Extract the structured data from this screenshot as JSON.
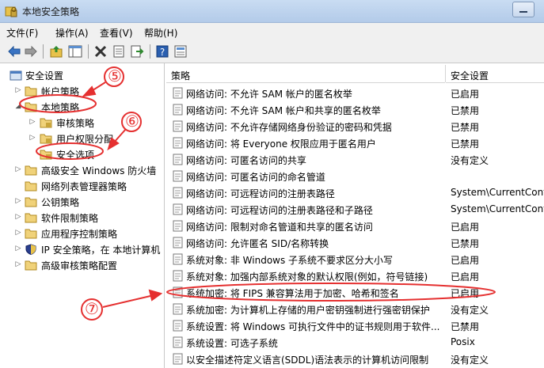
{
  "window": {
    "title": "本地安全策略"
  },
  "menu": [
    "文件(F)",
    "操作(A)",
    "查看(V)",
    "帮助(H)"
  ],
  "toolbar": [
    "back-icon",
    "forward-icon",
    "up-folder-icon",
    "show-tree-icon",
    "delete-icon",
    "properties-icon",
    "export-icon",
    "help-icon",
    "details-icon"
  ],
  "tree": {
    "root": "安全设置",
    "items": [
      "帐户策略",
      "本地策略",
      "审核策略",
      "用户权限分配",
      "安全选项",
      "高级安全 Windows 防火墙",
      "网络列表管理器策略",
      "公钥策略",
      "软件限制策略",
      "应用程序控制策略",
      "IP 安全策略，在 本地计算机",
      "高级审核策略配置"
    ]
  },
  "list": {
    "headers": [
      "策略",
      "安全设置"
    ],
    "rows": [
      {
        "name": "网络访问: 不允许 SAM 帐户的匿名枚举",
        "value": "已启用"
      },
      {
        "name": "网络访问: 不允许 SAM 帐户和共享的匿名枚举",
        "value": "已禁用"
      },
      {
        "name": "网络访问: 不允许存储网络身份验证的密码和凭据",
        "value": "已禁用"
      },
      {
        "name": "网络访问: 将 Everyone 权限应用于匿名用户",
        "value": "已禁用"
      },
      {
        "name": "网络访问: 可匿名访问的共享",
        "value": "没有定义"
      },
      {
        "name": "网络访问: 可匿名访问的命名管道",
        "value": ""
      },
      {
        "name": "网络访问: 可远程访问的注册表路径",
        "value": "System\\CurrentCont"
      },
      {
        "name": "网络访问: 可远程访问的注册表路径和子路径",
        "value": "System\\CurrentCont"
      },
      {
        "name": "网络访问: 限制对命名管道和共享的匿名访问",
        "value": "已启用"
      },
      {
        "name": "网络访问: 允许匿名 SID/名称转换",
        "value": "已禁用"
      },
      {
        "name": "系统对象: 非 Windows 子系统不要求区分大小写",
        "value": "已启用"
      },
      {
        "name": "系统对象: 加强内部系统对象的默认权限(例如，符号链接)",
        "value": "已启用"
      },
      {
        "name": "系统加密: 将 FIPS 兼容算法用于加密、哈希和签名",
        "value": "已启用"
      },
      {
        "name": "系统加密: 为计算机上存储的用户密钥强制进行强密钥保护",
        "value": "没有定义"
      },
      {
        "name": "系统设置: 将 Windows 可执行文件中的证书规则用于软件...",
        "value": "已禁用"
      },
      {
        "name": "系统设置: 可选子系统",
        "value": "Posix"
      },
      {
        "name": "以安全描述符定义语言(SDDL)语法表示的计算机访问限制",
        "value": "没有定义"
      }
    ]
  },
  "annotations": {
    "labels": [
      "⑤",
      "⑥",
      "⑦"
    ],
    "color": "#e53030"
  }
}
